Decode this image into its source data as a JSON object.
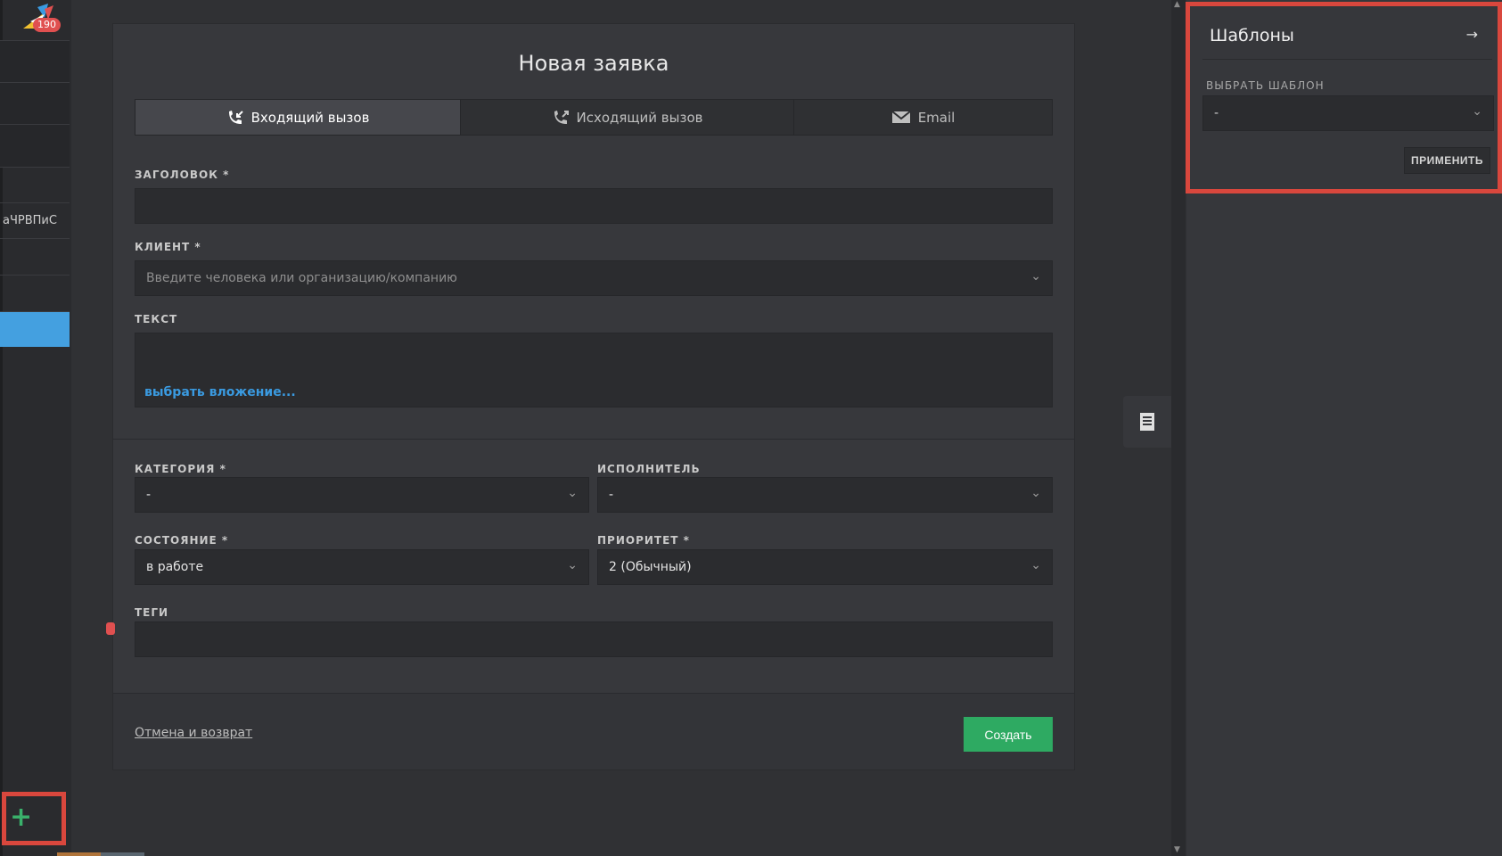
{
  "sidebar": {
    "badge": "190",
    "partial_item_text": "аЧРВПиС",
    "add_label": "+"
  },
  "form": {
    "title": "Новая заявка",
    "tabs": [
      {
        "label": "Входящий вызов",
        "icon": "incoming-call-icon",
        "active": true
      },
      {
        "label": "Исходящий вызов",
        "icon": "outgoing-call-icon",
        "active": false
      },
      {
        "label": "Email",
        "icon": "envelope-icon",
        "active": false
      }
    ],
    "fields": {
      "title_label": "ЗАГОЛОВОК *",
      "title_value": "",
      "client_label": "КЛИЕНТ *",
      "client_placeholder": "Введите человека или организацию/компанию",
      "text_label": "ТЕКСТ",
      "attach_link": "выбрать вложение...",
      "category_label": "КАТЕГОРИЯ *",
      "category_value": "-",
      "assignee_label": "ИСПОЛНИТЕЛЬ",
      "assignee_value": "-",
      "status_label": "СОСТОЯНИЕ *",
      "status_value": "в работе",
      "priority_label": "ПРИОРИТЕТ *",
      "priority_value": "2 (Обычный)",
      "tags_label": "ТЕГИ"
    },
    "footer": {
      "cancel_label": "Отмена и возврат",
      "create_label": "Создать"
    }
  },
  "templates_panel": {
    "title": "Шаблоны",
    "select_label": "ВЫБРАТЬ ШАБЛОН",
    "select_value": "-",
    "apply_label": "ПРИМЕНИТЬ"
  },
  "colors": {
    "accent_blue": "#44a0e0",
    "create_green": "#2eaa62",
    "highlight_red": "#d9473d"
  }
}
